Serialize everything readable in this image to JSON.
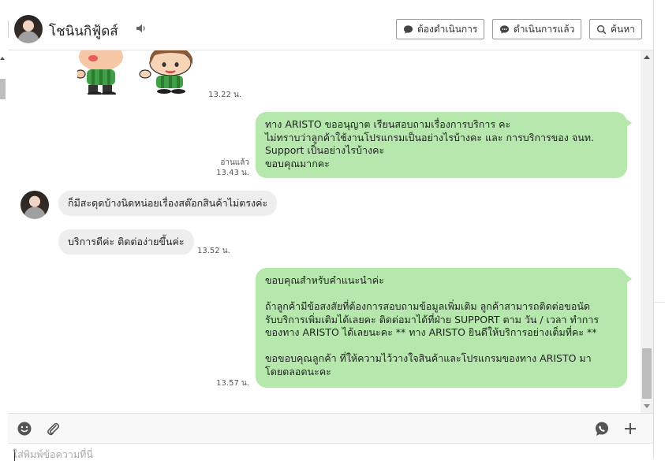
{
  "header": {
    "contact_name": "โชนินกิฟู้ดส์",
    "buttons": {
      "todo": "ต้องดำเนินการ",
      "done": "ดำเนินการแล้ว",
      "search": "ค้นหา"
    }
  },
  "messages": [
    {
      "type": "sticker",
      "direction": "in",
      "time": "13.22 น."
    },
    {
      "type": "text",
      "direction": "out",
      "status": "อ่านแล้ว",
      "time": "13.43 น.",
      "text": "ทาง ARISTO ขออนุญาต เรียนสอบถามเรื่องการบริการ คะ\nไม่ทราบว่าลูกค้าใช้งานโปรแกรมเป็นอย่างไรบ้างคะ และ การบริการของ จนท.\nSupport เป็นอย่างไรบ้างคะ\nขอบคุณมากคะ"
    },
    {
      "type": "text",
      "direction": "in",
      "text": "ก็มีสะดุดบ้างนิดหน่อยเรื่องสต๊อกสินค้าไม่ตรงค่ะ"
    },
    {
      "type": "text",
      "direction": "in",
      "time": "13.52 น.",
      "text": "บริการดีค่ะ ติดต่อง่ายขึ้นค่ะ"
    },
    {
      "type": "text",
      "direction": "out",
      "time": "13.57 น.",
      "text": "ขอบคุณสำหรับคำแนะนำค่ะ\n\nถ้าลูกค้ามีข้อสงสัยที่ต้องการสอบถามข้อมูลเพิ่มเติม ลูกค้าสามารถติดต่อขอนัด\nรับบริการเพิ่มเติมได้เลยคะ ติดต่อมาได้ที่ฝ่าย SUPPORT ตาม วัน / เวลา ทำการ\nของทาง ARISTO ได้เลยนะคะ ** ทาง ARISTO ยินดีให้บริการอย่างเต็มที่คะ **\n\nขอขอบคุณลูกค้า ที่ให้ความไว้วางใจสินค้าและโปรแกรมของทาง ARISTO มา\nโดยตลอดนะคะ"
    }
  ],
  "composer": {
    "placeholder": "ใส่พิมพ์ข้อความที่นี่",
    "icons": [
      "emoji-icon",
      "attachment-icon",
      "chat-bubble-icon",
      "plus-icon"
    ]
  },
  "colors": {
    "outgoing_bubble": "#b6e8ae",
    "incoming_bubble": "#eeeeee"
  }
}
